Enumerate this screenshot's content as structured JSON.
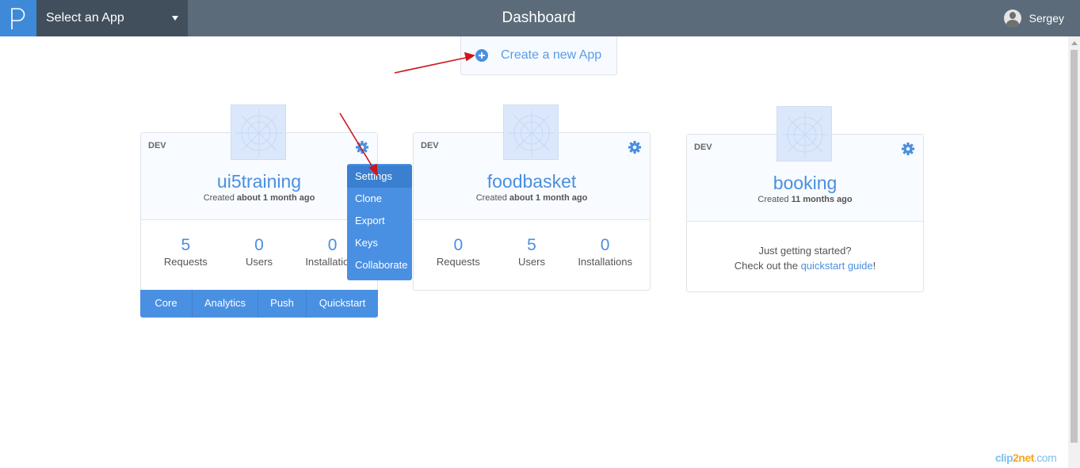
{
  "header": {
    "app_select": "Select an App",
    "title": "Dashboard",
    "user_name": "Sergey"
  },
  "create_app_label": "Create a new App",
  "apps": [
    {
      "env": "DEV",
      "name": "ui5training",
      "created_prefix": "Created",
      "created_when": "about 1 month ago",
      "stats": [
        {
          "value": "5",
          "label": "Requests"
        },
        {
          "value": "0",
          "label": "Users"
        },
        {
          "value": "0",
          "label": "Installations"
        }
      ],
      "tabs": [
        "Core",
        "Analytics",
        "Push",
        "Quickstart"
      ]
    },
    {
      "env": "DEV",
      "name": "foodbasket",
      "created_prefix": "Created",
      "created_when": "about 1 month ago",
      "stats": [
        {
          "value": "0",
          "label": "Requests"
        },
        {
          "value": "5",
          "label": "Users"
        },
        {
          "value": "0",
          "label": "Installations"
        }
      ]
    },
    {
      "env": "DEV",
      "name": "booking",
      "created_prefix": "Created",
      "created_when": "11 months ago",
      "getting_started": "Just getting started?",
      "checkout_prefix": "Check out the",
      "quickstart_link": "quickstart guide",
      "checkout_suffix": "!"
    }
  ],
  "settings_menu": [
    "Settings",
    "Clone",
    "Export",
    "Keys",
    "Collaborate"
  ],
  "watermark": {
    "part1": "clip",
    "part2": "2net",
    "part3": ".com"
  },
  "colors": {
    "topbar": "#5b6b7a",
    "accent": "#4a90e2",
    "annotation_arrow": "#d0141c"
  }
}
